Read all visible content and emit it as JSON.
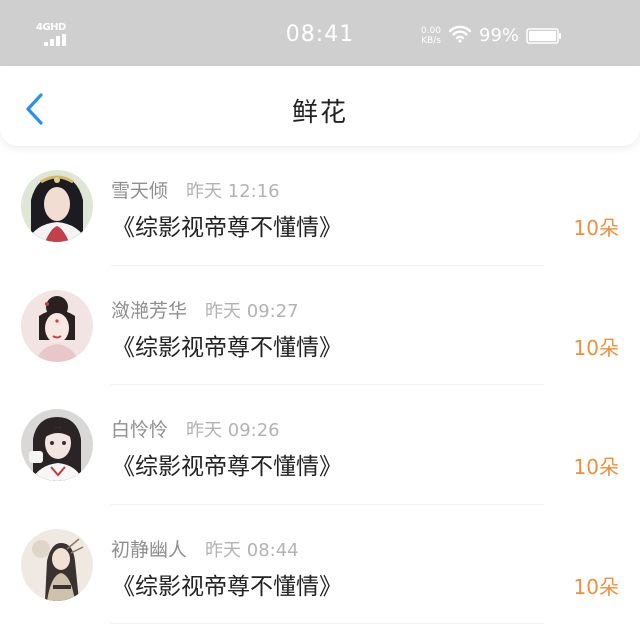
{
  "status_bar": {
    "network": "4GHD",
    "time": "08:41",
    "speed_value": "0.00",
    "speed_unit": "KB/s",
    "battery": "99%"
  },
  "nav": {
    "back_icon": "chevron-left-icon",
    "title": "鲜花"
  },
  "colors": {
    "status_bar_bg": "#cfcfcf",
    "back_icon": "#2b8ef0",
    "count_orange": "#ee8f3e",
    "username_gray": "#8f8f8f",
    "time_gray": "#b3b3b3",
    "title_dark": "#222222"
  },
  "items": [
    {
      "username": "雪天倾",
      "time": "昨天 12:16",
      "book": "《综影视帝尊不懂情》",
      "count": "10朵"
    },
    {
      "username": "潋滟芳华",
      "time": "昨天 09:27",
      "book": "《综影视帝尊不懂情》",
      "count": "10朵"
    },
    {
      "username": "白怜怜",
      "time": "昨天 09:26",
      "book": "《综影视帝尊不懂情》",
      "count": "10朵"
    },
    {
      "username": "初静幽人",
      "time": "昨天 08:44",
      "book": "《综影视帝尊不懂情》",
      "count": "10朵"
    }
  ]
}
